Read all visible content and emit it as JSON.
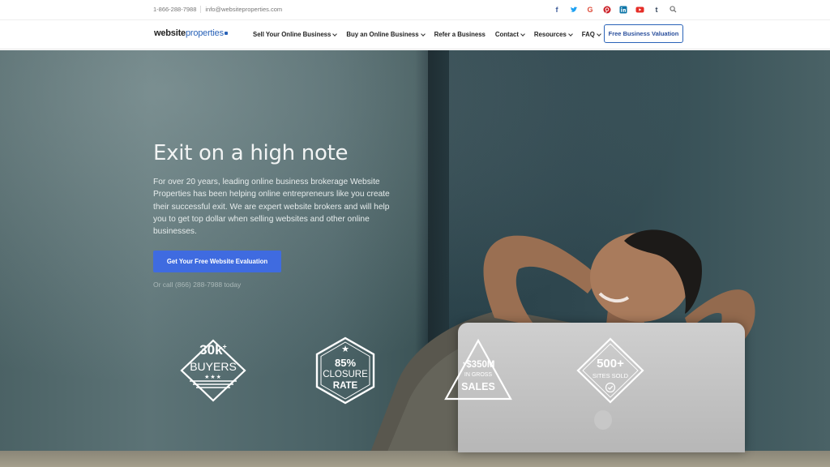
{
  "topbar": {
    "phone": "1-866-288-7988",
    "email": "info@websiteproperties.com",
    "social_icons": [
      "facebook-icon",
      "twitter-icon",
      "google-icon",
      "pinterest-icon",
      "linkedin-icon",
      "youtube-icon",
      "tumblr-icon",
      "search-icon"
    ],
    "social_glyphs": {
      "facebook": "f",
      "google": "G",
      "tumblr": "t"
    }
  },
  "nav": {
    "logo_part1": "website",
    "logo_part2": "properties",
    "items": [
      {
        "label": "Sell Your Online Business",
        "has_dropdown": true
      },
      {
        "label": "Buy an Online Business",
        "has_dropdown": true
      },
      {
        "label": "Refer a Business",
        "has_dropdown": false
      },
      {
        "label": "Contact",
        "has_dropdown": true
      },
      {
        "label": "Resources",
        "has_dropdown": true
      },
      {
        "label": "FAQ",
        "has_dropdown": true
      }
    ],
    "cta_label": "Free Business Valuation"
  },
  "hero": {
    "title": "Exit on a high note",
    "description": "For over 20 years, leading online business brokerage Website Properties has been helping online entrepreneurs like you create their successful exit. We are expert website brokers and will help you to get top dollar when selling websites and other online businesses.",
    "button_label": "Get Your Free Website Evaluation",
    "call_text": "Or call (866) 288-7988 today"
  },
  "badges": [
    {
      "big": "30k",
      "sup": "+",
      "small": "BUYERS",
      "stars": "★★★"
    },
    {
      "big": "85%",
      "mid": "CLOSURE",
      "small": "RATE",
      "star": "★"
    },
    {
      "big": "↑$350M",
      "mid": "IN GROSS",
      "small": "SALES"
    },
    {
      "big": "500+",
      "mid": "SITES SOLD",
      "icon": "check-circle-icon"
    }
  ],
  "colors": {
    "brand_blue": "#2a63b8",
    "cta_blue": "#3f6be0"
  }
}
